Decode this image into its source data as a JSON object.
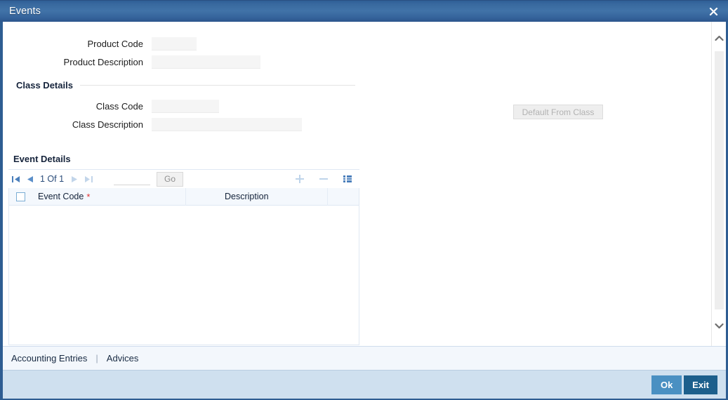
{
  "window": {
    "title": "Events",
    "close_icon": "close-icon"
  },
  "form": {
    "product_code": {
      "label": "Product Code",
      "value": "",
      "placeholder": ""
    },
    "product_description": {
      "label": "Product Description",
      "value": "",
      "placeholder": ""
    }
  },
  "class_details": {
    "title": "Class Details",
    "class_code": {
      "label": "Class Code",
      "value": "",
      "placeholder": ""
    },
    "class_description": {
      "label": "Class Description",
      "value": "",
      "placeholder": ""
    },
    "default_from_class_label": "Default From Class"
  },
  "event_details": {
    "title": "Event Details",
    "toolbar": {
      "first_icon": "first-page-icon",
      "prev_icon": "previous-page-icon",
      "page_indicator": "1 Of 1",
      "next_icon": "next-page-icon",
      "last_icon": "last-page-icon",
      "goto_value": "",
      "goto_placeholder": "",
      "go_label": "Go",
      "add_icon": "add-row-icon",
      "remove_icon": "remove-row-icon",
      "detail_icon": "single-view-icon"
    },
    "columns": [
      {
        "key": "select",
        "label": ""
      },
      {
        "key": "event_code",
        "label": "Event Code",
        "required": true,
        "required_marker": "*"
      },
      {
        "key": "description",
        "label": "Description",
        "required": false
      }
    ],
    "rows": []
  },
  "footer": {
    "links": [
      {
        "label": "Accounting Entries"
      },
      {
        "label": "Advices"
      }
    ],
    "separator": "|",
    "buttons": {
      "ok_label": "Ok",
      "exit_label": "Exit"
    }
  },
  "scrollbar": {
    "up_icon": "chevron-up-icon",
    "down_icon": "chevron-down-icon"
  },
  "colors": {
    "titlebar_blue": "#3a6ba2",
    "accent_blue": "#2e5d92",
    "ok_button": "#4a90c2",
    "exit_button": "#1c5f8c",
    "button_bar": "#cfe0ef",
    "links_bar": "#f3f7fc",
    "field_fill": "#f5f5f5",
    "required_star": "#e03131"
  }
}
